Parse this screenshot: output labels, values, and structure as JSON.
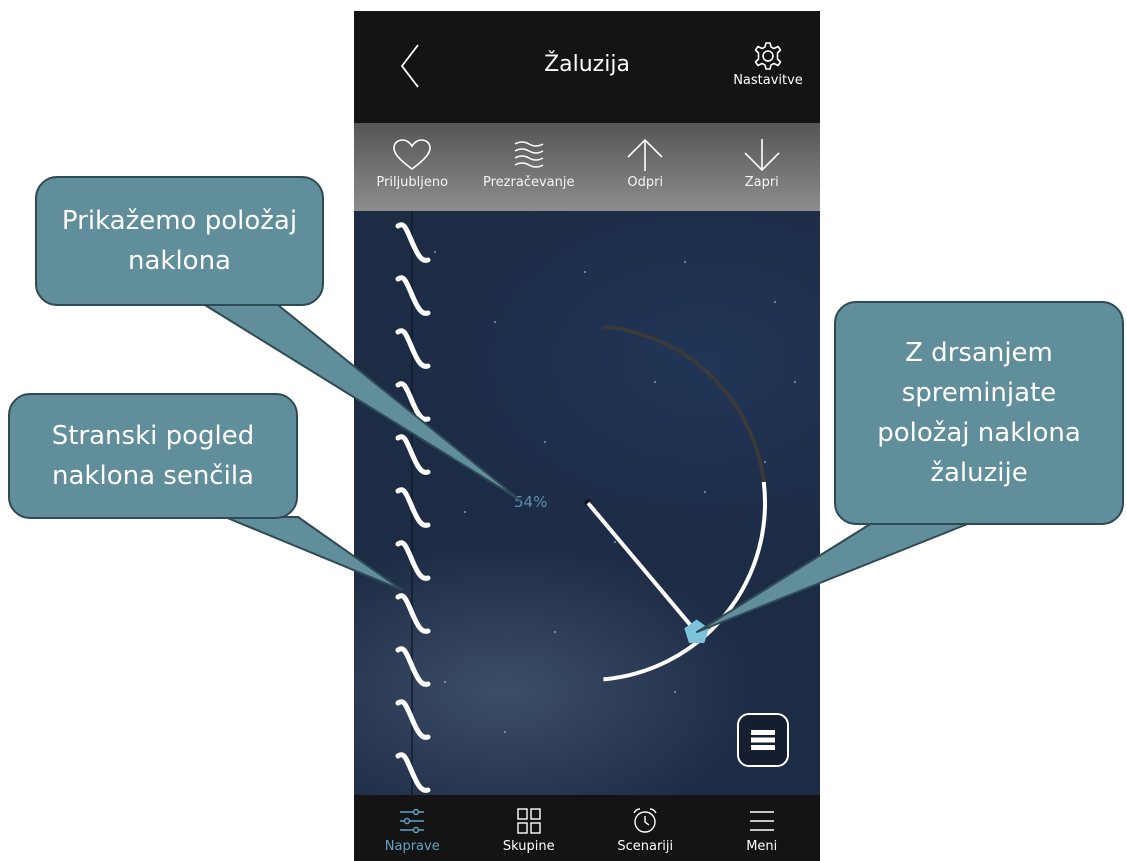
{
  "header": {
    "title": "Žaluzija",
    "settings_label": "Nastavitve"
  },
  "actions": [
    {
      "label": "Priljubljeno",
      "icon": "heart-icon"
    },
    {
      "label": "Prezračevanje",
      "icon": "waves-icon"
    },
    {
      "label": "Odpri",
      "icon": "arrow-up-icon"
    },
    {
      "label": "Zapri",
      "icon": "arrow-down-icon"
    }
  ],
  "tilt": {
    "percent_label": "54%",
    "value": 0.54
  },
  "nav": [
    {
      "label": "Naprave",
      "icon": "sliders-icon",
      "active": true
    },
    {
      "label": "Skupine",
      "icon": "grid-icon",
      "active": false
    },
    {
      "label": "Scenariji",
      "icon": "alarm-clock-icon",
      "active": false
    },
    {
      "label": "Meni",
      "icon": "menu-icon",
      "active": false
    }
  ],
  "callouts": {
    "tilt_position": "Prikažemo položaj naklona",
    "side_view": "Stranski pogled naklona senčila",
    "drag_hint": "Z drsanjem spreminjate položaj naklona žaluzije"
  },
  "colors": {
    "accent": "#5fa3c6",
    "handle": "#7ec3dc",
    "callout_fill": "#618e9b",
    "background": "#1d2c45"
  }
}
